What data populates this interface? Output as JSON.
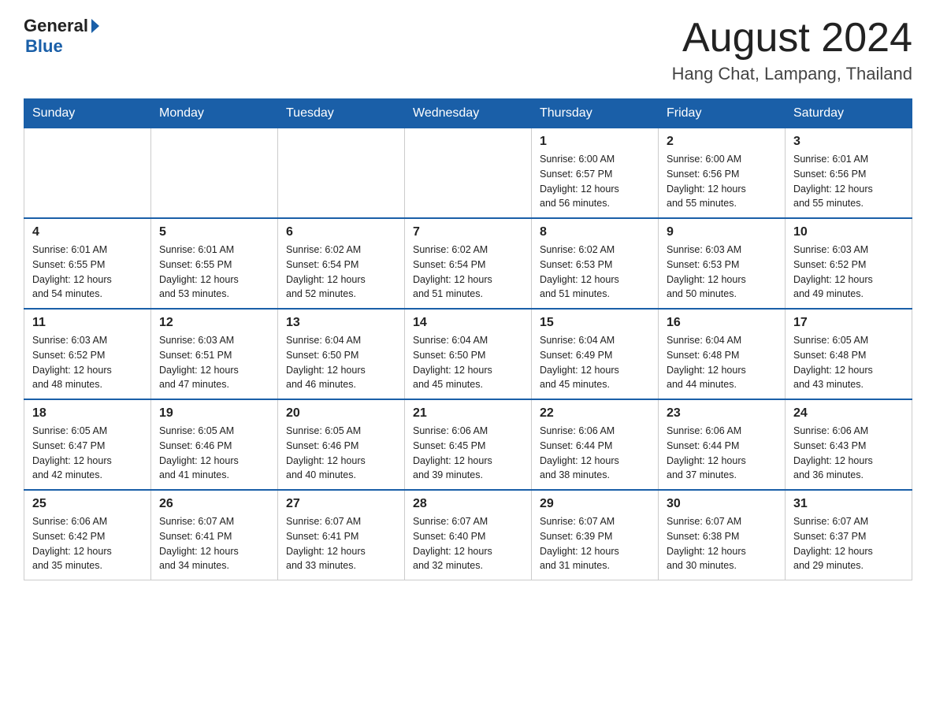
{
  "header": {
    "logo_general": "General",
    "logo_blue": "Blue",
    "month_title": "August 2024",
    "location": "Hang Chat, Lampang, Thailand"
  },
  "days_of_week": [
    "Sunday",
    "Monday",
    "Tuesday",
    "Wednesday",
    "Thursday",
    "Friday",
    "Saturday"
  ],
  "weeks": [
    [
      {
        "day": "",
        "info": ""
      },
      {
        "day": "",
        "info": ""
      },
      {
        "day": "",
        "info": ""
      },
      {
        "day": "",
        "info": ""
      },
      {
        "day": "1",
        "info": "Sunrise: 6:00 AM\nSunset: 6:57 PM\nDaylight: 12 hours\nand 56 minutes."
      },
      {
        "day": "2",
        "info": "Sunrise: 6:00 AM\nSunset: 6:56 PM\nDaylight: 12 hours\nand 55 minutes."
      },
      {
        "day": "3",
        "info": "Sunrise: 6:01 AM\nSunset: 6:56 PM\nDaylight: 12 hours\nand 55 minutes."
      }
    ],
    [
      {
        "day": "4",
        "info": "Sunrise: 6:01 AM\nSunset: 6:55 PM\nDaylight: 12 hours\nand 54 minutes."
      },
      {
        "day": "5",
        "info": "Sunrise: 6:01 AM\nSunset: 6:55 PM\nDaylight: 12 hours\nand 53 minutes."
      },
      {
        "day": "6",
        "info": "Sunrise: 6:02 AM\nSunset: 6:54 PM\nDaylight: 12 hours\nand 52 minutes."
      },
      {
        "day": "7",
        "info": "Sunrise: 6:02 AM\nSunset: 6:54 PM\nDaylight: 12 hours\nand 51 minutes."
      },
      {
        "day": "8",
        "info": "Sunrise: 6:02 AM\nSunset: 6:53 PM\nDaylight: 12 hours\nand 51 minutes."
      },
      {
        "day": "9",
        "info": "Sunrise: 6:03 AM\nSunset: 6:53 PM\nDaylight: 12 hours\nand 50 minutes."
      },
      {
        "day": "10",
        "info": "Sunrise: 6:03 AM\nSunset: 6:52 PM\nDaylight: 12 hours\nand 49 minutes."
      }
    ],
    [
      {
        "day": "11",
        "info": "Sunrise: 6:03 AM\nSunset: 6:52 PM\nDaylight: 12 hours\nand 48 minutes."
      },
      {
        "day": "12",
        "info": "Sunrise: 6:03 AM\nSunset: 6:51 PM\nDaylight: 12 hours\nand 47 minutes."
      },
      {
        "day": "13",
        "info": "Sunrise: 6:04 AM\nSunset: 6:50 PM\nDaylight: 12 hours\nand 46 minutes."
      },
      {
        "day": "14",
        "info": "Sunrise: 6:04 AM\nSunset: 6:50 PM\nDaylight: 12 hours\nand 45 minutes."
      },
      {
        "day": "15",
        "info": "Sunrise: 6:04 AM\nSunset: 6:49 PM\nDaylight: 12 hours\nand 45 minutes."
      },
      {
        "day": "16",
        "info": "Sunrise: 6:04 AM\nSunset: 6:48 PM\nDaylight: 12 hours\nand 44 minutes."
      },
      {
        "day": "17",
        "info": "Sunrise: 6:05 AM\nSunset: 6:48 PM\nDaylight: 12 hours\nand 43 minutes."
      }
    ],
    [
      {
        "day": "18",
        "info": "Sunrise: 6:05 AM\nSunset: 6:47 PM\nDaylight: 12 hours\nand 42 minutes."
      },
      {
        "day": "19",
        "info": "Sunrise: 6:05 AM\nSunset: 6:46 PM\nDaylight: 12 hours\nand 41 minutes."
      },
      {
        "day": "20",
        "info": "Sunrise: 6:05 AM\nSunset: 6:46 PM\nDaylight: 12 hours\nand 40 minutes."
      },
      {
        "day": "21",
        "info": "Sunrise: 6:06 AM\nSunset: 6:45 PM\nDaylight: 12 hours\nand 39 minutes."
      },
      {
        "day": "22",
        "info": "Sunrise: 6:06 AM\nSunset: 6:44 PM\nDaylight: 12 hours\nand 38 minutes."
      },
      {
        "day": "23",
        "info": "Sunrise: 6:06 AM\nSunset: 6:44 PM\nDaylight: 12 hours\nand 37 minutes."
      },
      {
        "day": "24",
        "info": "Sunrise: 6:06 AM\nSunset: 6:43 PM\nDaylight: 12 hours\nand 36 minutes."
      }
    ],
    [
      {
        "day": "25",
        "info": "Sunrise: 6:06 AM\nSunset: 6:42 PM\nDaylight: 12 hours\nand 35 minutes."
      },
      {
        "day": "26",
        "info": "Sunrise: 6:07 AM\nSunset: 6:41 PM\nDaylight: 12 hours\nand 34 minutes."
      },
      {
        "day": "27",
        "info": "Sunrise: 6:07 AM\nSunset: 6:41 PM\nDaylight: 12 hours\nand 33 minutes."
      },
      {
        "day": "28",
        "info": "Sunrise: 6:07 AM\nSunset: 6:40 PM\nDaylight: 12 hours\nand 32 minutes."
      },
      {
        "day": "29",
        "info": "Sunrise: 6:07 AM\nSunset: 6:39 PM\nDaylight: 12 hours\nand 31 minutes."
      },
      {
        "day": "30",
        "info": "Sunrise: 6:07 AM\nSunset: 6:38 PM\nDaylight: 12 hours\nand 30 minutes."
      },
      {
        "day": "31",
        "info": "Sunrise: 6:07 AM\nSunset: 6:37 PM\nDaylight: 12 hours\nand 29 minutes."
      }
    ]
  ]
}
